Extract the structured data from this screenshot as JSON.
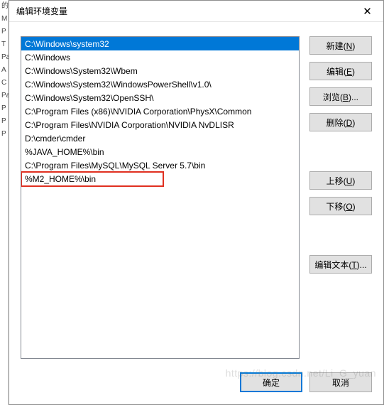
{
  "dialog": {
    "title": "编辑环境变量",
    "close_glyph": "✕"
  },
  "list": {
    "items": [
      "C:\\Windows\\system32",
      "C:\\Windows",
      "C:\\Windows\\System32\\Wbem",
      "C:\\Windows\\System32\\WindowsPowerShell\\v1.0\\",
      "C:\\Windows\\System32\\OpenSSH\\",
      "C:\\Program Files (x86)\\NVIDIA Corporation\\PhysX\\Common",
      "C:\\Program Files\\NVIDIA Corporation\\NVIDIA NvDLISR",
      "D:\\cmder\\cmder",
      "%JAVA_HOME%\\bin",
      "C:\\Program Files\\MySQL\\MySQL Server 5.7\\bin",
      "%M2_HOME%\\bin"
    ],
    "selected_index": 0,
    "highlight_index": 10
  },
  "buttons": {
    "new": {
      "text": "新建",
      "accel": "N"
    },
    "edit": {
      "text": "编辑",
      "accel": "E"
    },
    "browse": {
      "text": "浏览",
      "accel": "B"
    },
    "delete": {
      "text": "删除",
      "accel": "D"
    },
    "move_up": {
      "text": "上移",
      "accel": "U"
    },
    "move_down": {
      "text": "下移",
      "accel": "O"
    },
    "edit_text": {
      "text": "编辑文本",
      "accel": "T"
    }
  },
  "footer": {
    "ok": "确定",
    "cancel": "取消"
  },
  "left_strip_chars": [
    "的",
    "M",
    "P",
    "T",
    "",
    "",
    "",
    "",
    "",
    "",
    "",
    "",
    "",
    "",
    "",
    "",
    "",
    "",
    "",
    "Pa",
    "A",
    "C",
    "Pa",
    "P",
    "P",
    "",
    "",
    "",
    "",
    "P"
  ],
  "watermark": "https://blog.csdn.net/Li_G_yuan"
}
